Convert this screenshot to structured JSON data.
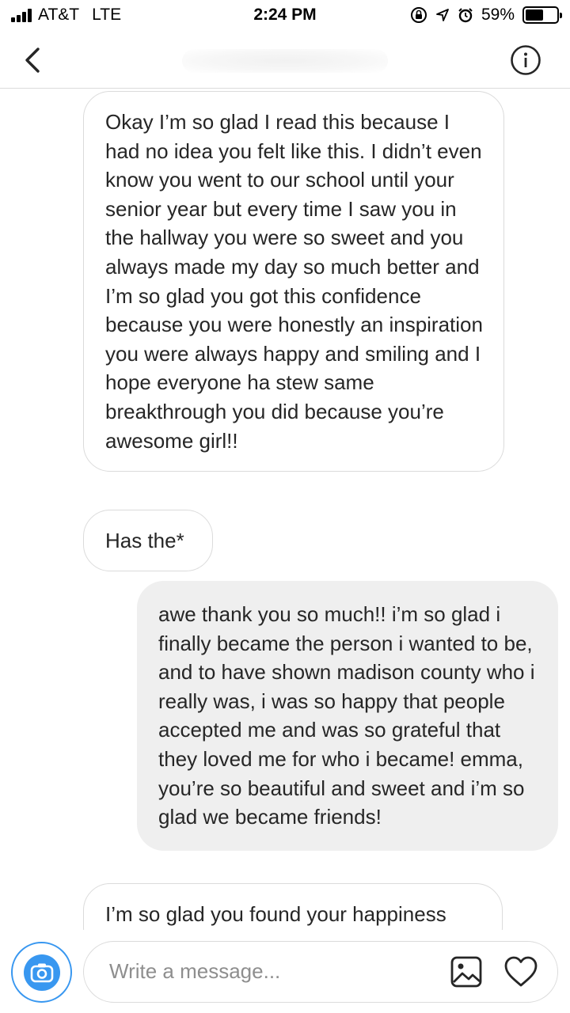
{
  "status_bar": {
    "carrier": "AT&T",
    "network": "LTE",
    "time": "2:24 PM",
    "battery_percent": "59%",
    "battery_level": 0.59,
    "icons": [
      "signal-icon",
      "orientation-lock-icon",
      "location-arrow-icon",
      "alarm-icon",
      "battery-icon"
    ]
  },
  "header": {
    "back_icon": "chevron-left-icon",
    "info_icon": "info-circle-icon"
  },
  "messages": [
    {
      "direction": "received",
      "text": "Okay I’m so glad I read this because I had no idea you felt like this. I didn’t even know you went to our school until your senior year but every time I saw you in the hallway you were so sweet and you always made my day so much better and I’m so glad you got this confidence because you were honestly an inspiration you were always happy and smiling and I hope everyone ha stew same breakthrough you did because you’re awesome girl!!"
    },
    {
      "direction": "received",
      "text": "Has the*"
    },
    {
      "direction": "sent",
      "text": "awe thank you so much!! i’m so glad i finally became the person i wanted to be, and to have shown madison county who i really was, i was so happy that people accepted me and was so grateful that they loved me for who i became! emma, you’re so beautiful and sweet and i’m so glad we became friends!"
    },
    {
      "direction": "received",
      "text": "I’m so glad you found your happiness"
    }
  ],
  "composer": {
    "placeholder": "Write a message...",
    "value": "",
    "camera_icon": "camera-icon",
    "gallery_icon": "image-gallery-icon",
    "heart_icon": "heart-icon"
  },
  "colors": {
    "accent": "#3897f0",
    "sent_bubble": "#efefef",
    "border": "#dbdbdb",
    "text": "#262626",
    "placeholder": "#8e8e8e"
  }
}
